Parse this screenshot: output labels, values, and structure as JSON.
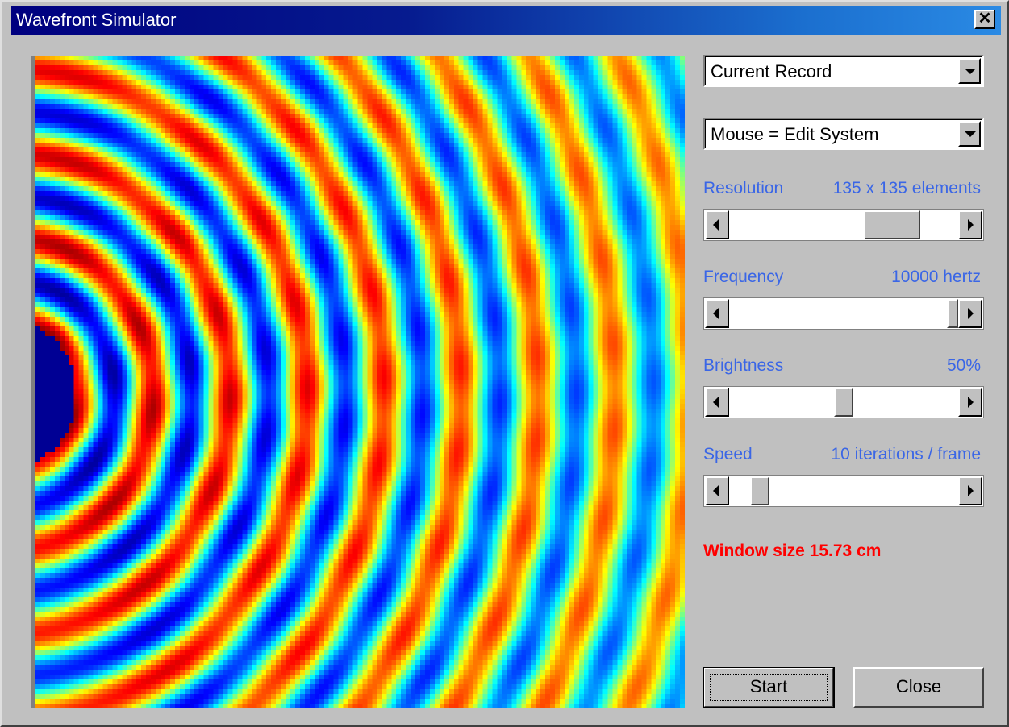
{
  "window": {
    "title": "Wavefront Simulator",
    "close_icon": "close-icon",
    "close_glyph": "✕"
  },
  "simulation": {
    "colormap": "jet",
    "source_side": "left",
    "wavelength_cells": 16
  },
  "record_select": {
    "value": "Current Record"
  },
  "mouse_select": {
    "value": "Mouse = Edit System"
  },
  "controls": {
    "resolution": {
      "label": "Resolution",
      "value_text": "135 x 135 elements",
      "position": 0.78
    },
    "frequency": {
      "label": "Frequency",
      "value_text": "10000 hertz",
      "position": 1.0
    },
    "brightness": {
      "label": "Brightness",
      "value_text": "50%",
      "position": 0.5
    },
    "speed": {
      "label": "Speed",
      "value_text": "10 iterations / frame",
      "position": 0.1
    }
  },
  "status": {
    "text": "Window size 15.73 cm",
    "color": "#ff0000"
  },
  "buttons": {
    "start": "Start",
    "close": "Close"
  },
  "colors": {
    "title_start": "#00007f",
    "title_end": "#2a8ae4",
    "label": "#3a66e6",
    "face": "#c0c0c0"
  }
}
